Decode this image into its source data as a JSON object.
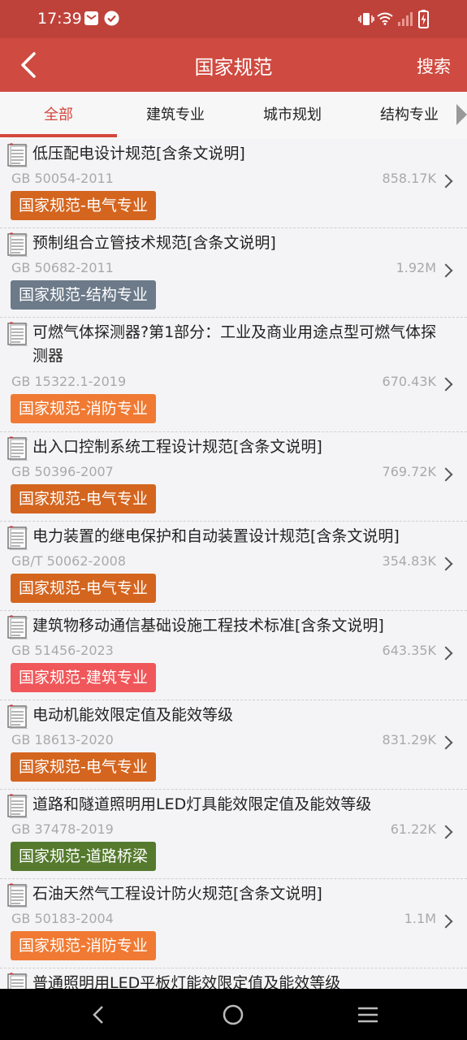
{
  "status": {
    "time": "17:39"
  },
  "header": {
    "back_icon": "back-chevron-icon",
    "title": "国家规范",
    "search_label": "搜索"
  },
  "tabs": [
    {
      "label": "全部",
      "active": true
    },
    {
      "label": "建筑专业",
      "active": false
    },
    {
      "label": "城市规划",
      "active": false
    },
    {
      "label": "结构专业",
      "active": false
    }
  ],
  "items": [
    {
      "title": "低压配电设计规范[含条文说明]",
      "code": "GB 50054-2011",
      "size": "858.17K",
      "tag": "国家规范-电气专业",
      "tag_color": "#d4651f"
    },
    {
      "title": "预制组合立管技术规范[含条文说明]",
      "code": "GB 50682-2011",
      "size": "1.92M",
      "tag": "国家规范-结构专业",
      "tag_color": "#6c7a89"
    },
    {
      "title": "可燃气体探测器?第1部分：工业及商业用途点型可燃气体探测器",
      "code": "GB 15322.1-2019",
      "size": "670.43K",
      "tag": "国家规范-消防专业",
      "tag_color": "#f07a33"
    },
    {
      "title": "出入口控制系统工程设计规范[含条文说明]",
      "code": "GB 50396-2007",
      "size": "769.72K",
      "tag": "国家规范-电气专业",
      "tag_color": "#d4651f"
    },
    {
      "title": "电力装置的继电保护和自动装置设计规范[含条文说明]",
      "code": "GB/T 50062-2008",
      "size": "354.83K",
      "tag": "国家规范-电气专业",
      "tag_color": "#d4651f"
    },
    {
      "title": "建筑物移动通信基础设施工程技术标准[含条文说明]",
      "code": "GB 51456-2023",
      "size": "643.35K",
      "tag": "国家规范-建筑专业",
      "tag_color": "#f0575a"
    },
    {
      "title": "电动机能效限定值及能效等级",
      "code": "GB 18613-2020",
      "size": "831.29K",
      "tag": "国家规范-电气专业",
      "tag_color": "#d4651f"
    },
    {
      "title": "道路和隧道照明用LED灯具能效限定值及能效等级",
      "code": "GB 37478-2019",
      "size": "61.22K",
      "tag": "国家规范-道路桥梁",
      "tag_color": "#557a2e"
    },
    {
      "title": "石油天然气工程设计防火规范[含条文说明]",
      "code": "GB 50183-2004",
      "size": "1.1M",
      "tag": "国家规范-消防专业",
      "tag_color": "#f07a33"
    },
    {
      "title": "普通照明用LED平板灯能效限定值及能效等级",
      "code": "",
      "size": "",
      "tag": "",
      "tag_color": ""
    }
  ]
}
